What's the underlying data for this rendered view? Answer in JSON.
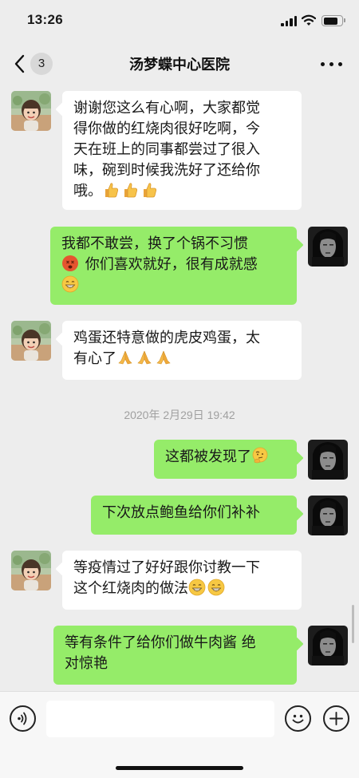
{
  "status_bar": {
    "time": "13:26",
    "battery_level": 0.85,
    "signal_icon": "cellular-signal-icon",
    "wifi_icon": "wifi-icon",
    "battery_icon": "battery-icon"
  },
  "nav": {
    "back_icon": "chevron-left-icon",
    "unread_count": "3",
    "title": "汤梦蝶中心医院",
    "more_icon": "more-dots-icon"
  },
  "messages": [
    {
      "side": "in",
      "lines": [
        "谢谢您这么有心啊，大家都觉",
        "得你做的红烧肉很好吃啊，今",
        "天在班上的同事都尝过了很入",
        "味，碗到时候我洗好了还给你",
        "哦。"
      ],
      "emoji": "thumbs-up-icon x3"
    },
    {
      "side": "out",
      "lines": [
        "我都不敢尝，换了个锅不习惯",
        "你们喜欢就好，很有成就感"
      ],
      "emoji": "dizzy-face-icon, grin-icon"
    },
    {
      "side": "in",
      "lines": [
        "鸡蛋还特意做的虎皮鸡蛋，太",
        "有心了"
      ],
      "emoji": "praying-hands-icon x3"
    },
    {
      "side": "out",
      "lines": [
        "这都被发现了"
      ],
      "emoji": "thinking-face-icon"
    },
    {
      "side": "out",
      "lines": [
        "下次放点鲍鱼给你们补补"
      ]
    },
    {
      "side": "in",
      "lines": [
        "等疫情过了好好跟你讨教一下",
        "这个红烧肉的做法"
      ],
      "emoji": "grin-icon x2"
    },
    {
      "side": "out",
      "lines": [
        "等有条件了给你们做牛肉酱 绝",
        "对惊艳"
      ]
    }
  ],
  "timestamp": "2020年 2月29日 19:42",
  "input_bar": {
    "voice_icon": "voice-icon",
    "emoji_icon": "smiley-icon",
    "plus_icon": "plus-icon",
    "placeholder": ""
  },
  "colors": {
    "background": "#ededed",
    "incoming_bubble": "#ffffff",
    "outgoing_bubble": "#95ec69",
    "timestamp_text": "#a0a0a0"
  }
}
